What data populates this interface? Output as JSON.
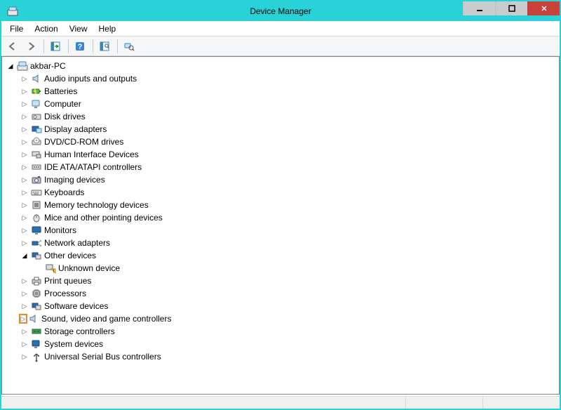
{
  "window": {
    "title": "Device Manager"
  },
  "menu": {
    "file": "File",
    "action": "Action",
    "view": "View",
    "help": "Help"
  },
  "tree": {
    "root": "akbar-PC",
    "audio": "Audio inputs and outputs",
    "batteries": "Batteries",
    "computer": "Computer",
    "disk": "Disk drives",
    "display": "Display adapters",
    "dvd": "DVD/CD-ROM drives",
    "hid": "Human Interface Devices",
    "ide": "IDE ATA/ATAPI controllers",
    "imaging": "Imaging devices",
    "keyboards": "Keyboards",
    "memtech": "Memory technology devices",
    "mice": "Mice and other pointing devices",
    "monitors": "Monitors",
    "network": "Network adapters",
    "other": "Other devices",
    "unknown": "Unknown device",
    "print": "Print queues",
    "processors": "Processors",
    "software": "Software devices",
    "sound": "Sound, video and game controllers",
    "storage": "Storage controllers",
    "system": "System devices",
    "usb": "Universal Serial Bus controllers"
  }
}
